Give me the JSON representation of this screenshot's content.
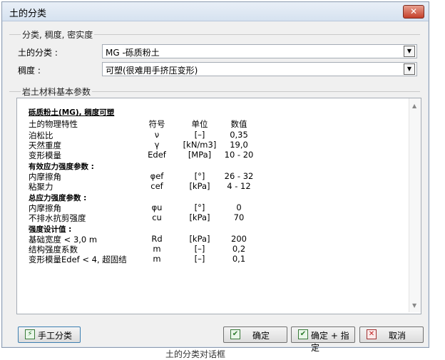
{
  "window": {
    "title": "土的分类",
    "close_glyph": "✕"
  },
  "section1": {
    "title": "分类, 稠度, 密实度",
    "soil_class_label": "土的分类 :",
    "soil_class_value": "MG -砾质粉土",
    "consistency_label": "稠度 :",
    "consistency_value": "可塑(很难用手挤压变形)"
  },
  "section2": {
    "title": "岩土材料基本参数",
    "heading": "砾质粉土(MG), 稠度可塑",
    "columns": {
      "property": "土的物理特性",
      "symbol": "符号",
      "unit": "单位",
      "value": "数值"
    },
    "rows1": [
      {
        "p": "泊松比",
        "s": "ν",
        "u": "[–]",
        "v": "0,35"
      },
      {
        "p": "天然重度",
        "s": "γ",
        "u": "[kN/m3]",
        "v": "19,0"
      },
      {
        "p": "变形模量",
        "s": "Edef",
        "u": "[MPa]",
        "v": "10 - 20"
      }
    ],
    "effective_title": "有效应力强度参数 :",
    "rows2": [
      {
        "p": "内摩擦角",
        "s": "φef",
        "u": "[°]",
        "v": "26 - 32"
      },
      {
        "p": "粘聚力",
        "s": "cef",
        "u": "[kPa]",
        "v": "4 - 12"
      }
    ],
    "total_title": "总应力强度参数 :",
    "rows3": [
      {
        "p": "内摩擦角",
        "s": "φu",
        "u": "[°]",
        "v": "0"
      },
      {
        "p": "不排水抗剪强度",
        "s": "cu",
        "u": "[kPa]",
        "v": "70"
      }
    ],
    "design_title": "强度设计值 :",
    "rows4": [
      {
        "p": "基础宽度 < 3,0 m",
        "s": "Rd",
        "u": "[kPa]",
        "v": "200"
      },
      {
        "p": "结构强度系数",
        "s": "m",
        "u": "[–]",
        "v": "0,2"
      },
      {
        "p": "变形模量Edef < 4, 超固结",
        "s": "m",
        "u": "[–]",
        "v": "0,1"
      }
    ]
  },
  "buttons": {
    "manual": "手工分类",
    "ok": "确定",
    "ok_assign": "确定 + 指定",
    "cancel": "取消"
  },
  "caption": "土的分类对话框"
}
